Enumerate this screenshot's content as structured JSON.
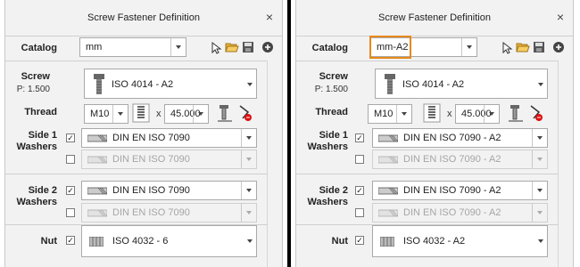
{
  "dialog_title": "Screw Fastener Definition",
  "close_glyph": "×",
  "labels": {
    "catalog": "Catalog",
    "screw": "Screw",
    "pitch": "P: 1.500",
    "thread": "Thread",
    "side1": "Side 1",
    "side2": "Side 2",
    "washers": "Washers",
    "nut": "Nut",
    "times": "x"
  },
  "left": {
    "catalog": "mm",
    "screw": "ISO 4014 - A2",
    "thread_size": "M10",
    "length": "45.000",
    "side1_washer": "DIN EN ISO 7090",
    "side1_washer2": "DIN EN ISO 7090",
    "side2_washer": "DIN EN ISO 7090",
    "side2_washer2": "DIN EN ISO 7090",
    "nut": "ISO 4032 - 6",
    "checks": {
      "side1": "✓",
      "side2": "✓",
      "nut": "✓"
    }
  },
  "right": {
    "catalog": "mm-A2",
    "screw": "ISO 4014 - A2",
    "thread_size": "M10",
    "length": "45.000",
    "side1_washer": "DIN EN ISO 7090 - A2",
    "side1_washer2": "DIN EN ISO 7090 - A2",
    "side2_washer": "DIN EN ISO 7090 - A2",
    "side2_washer2": "DIN EN ISO 7090 - A2",
    "nut": "ISO 4032 - A2",
    "checks": {
      "side1": "✓",
      "side2": "✓",
      "nut": "✓"
    }
  },
  "colors": {
    "highlight": "#e8891a",
    "divider": "#000000"
  }
}
